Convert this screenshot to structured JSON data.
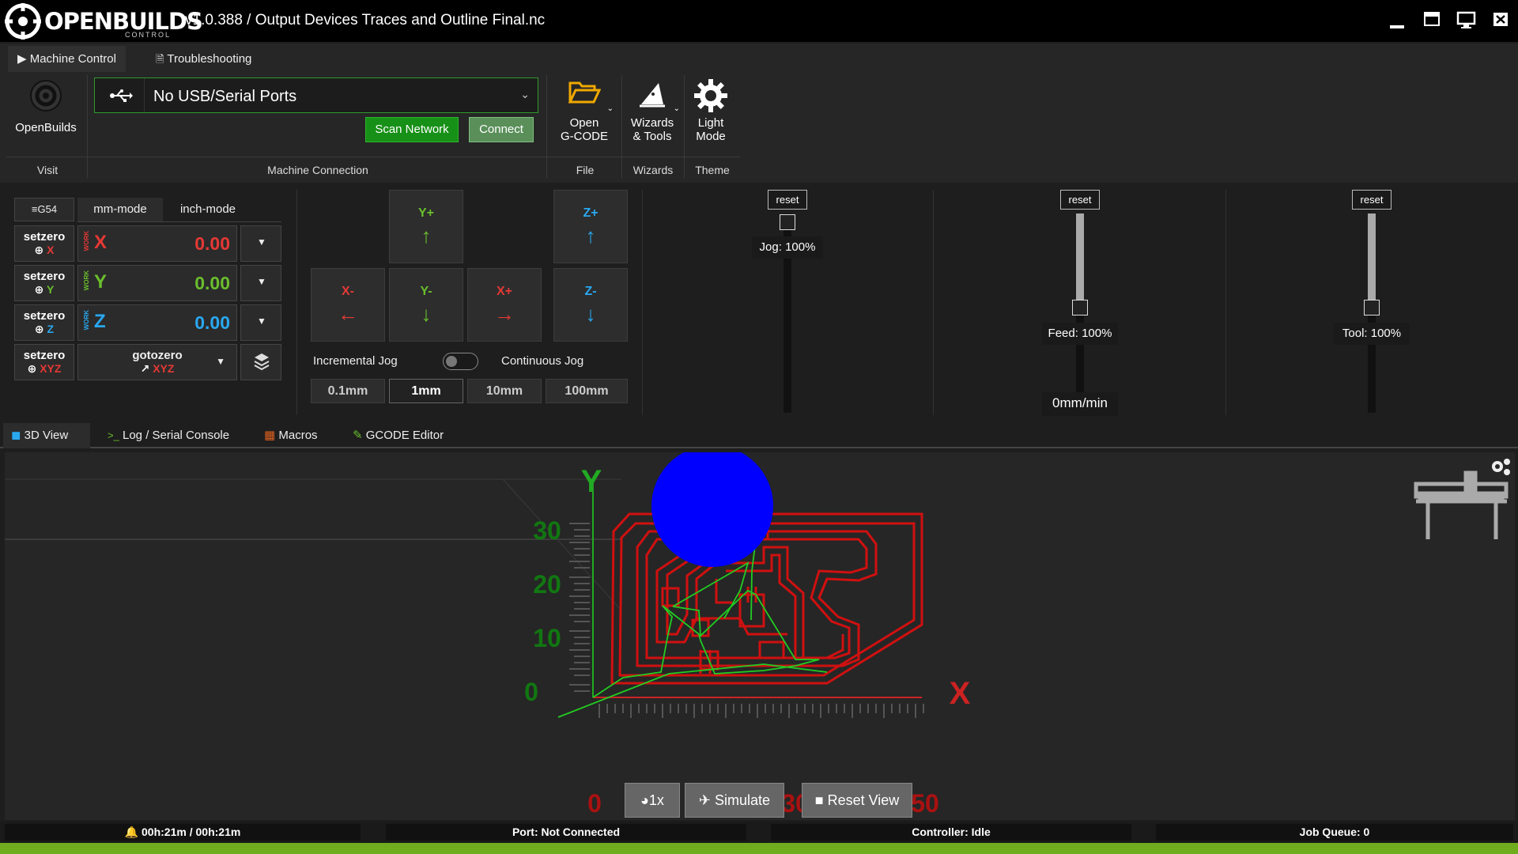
{
  "app": {
    "logo_text": "OPENBUILDS",
    "logo_sub": "CONTROL",
    "window_title": "v1.0.388 / Output Devices Traces and Outline Final.nc"
  },
  "top_tabs": [
    {
      "label": "Machine Control",
      "icon": "play-icon"
    },
    {
      "label": "Troubleshooting",
      "icon": "document-icon"
    }
  ],
  "ribbon": {
    "visit": {
      "button": "OpenBuilds",
      "group": "Visit"
    },
    "connection": {
      "port_value": "No USB/Serial Ports",
      "scan_label": "Scan Network",
      "connect_label": "Connect",
      "group": "Machine Connection"
    },
    "file": {
      "line1": "Open",
      "line2": "G-CODE",
      "group": "File"
    },
    "wizards": {
      "line1": "Wizards",
      "line2": "& Tools",
      "group": "Wizards"
    },
    "theme": {
      "line1": "Light",
      "line2": "Mode",
      "group": "Theme"
    }
  },
  "dro": {
    "wcs": "G54",
    "modes": [
      "mm-mode",
      "inch-mode"
    ],
    "setzero_label": "setzero",
    "work_label": "WORK",
    "axes": [
      {
        "axis": "X",
        "value": "0.00",
        "color": "#e53935"
      },
      {
        "axis": "Y",
        "value": "0.00",
        "color": "#6abf2c"
      },
      {
        "axis": "Z",
        "value": "0.00",
        "color": "#29a8f0"
      }
    ],
    "xyz_label": "XYZ",
    "gotozero_label": "gotozero"
  },
  "jog": {
    "y_plus": "Y+",
    "y_minus": "Y-",
    "x_plus": "X+",
    "x_minus": "X-",
    "z_plus": "Z+",
    "z_minus": "Z-",
    "incremental": "Incremental Jog",
    "continuous": "Continuous Jog",
    "steps": [
      "0.1mm",
      "1mm",
      "10mm",
      "100mm"
    ],
    "active_step": "1mm"
  },
  "overrides": {
    "reset_label": "reset",
    "jog": {
      "label": "Jog: 100%",
      "level": 1.0
    },
    "feed": {
      "label": "Feed: 100%",
      "rate": "0mm/min",
      "level": 0.5
    },
    "tool": {
      "label": "Tool: 100%",
      "level": 0.5
    }
  },
  "lower_tabs": [
    {
      "label": "3D View",
      "icon": "cube-icon"
    },
    {
      "label": "Log / Serial Console",
      "icon": "terminal-icon"
    },
    {
      "label": "Macros",
      "icon": "grid-icon"
    },
    {
      "label": "GCODE Editor",
      "icon": "edit-icon"
    }
  ],
  "view3d": {
    "axis_x": "X",
    "axis_y": "Y",
    "y_ticks": [
      "30",
      "20",
      "10",
      "0"
    ],
    "x_ticks": [
      "0",
      "30",
      "50"
    ],
    "speed_label": "1x",
    "simulate_label": "Simulate",
    "reset_view_label": "Reset View"
  },
  "status": {
    "time": "00h:21m / 00h:21m",
    "port": "Port: Not Connected",
    "controller": "Controller: Idle",
    "queue": "Job Queue: 0"
  },
  "colors": {
    "accent_green": "#2e9b2e",
    "trace_red": "#d01010",
    "toolpath_green": "#22cc22",
    "tool_blue": "#0000ff",
    "status_green": "#6fad1f"
  }
}
